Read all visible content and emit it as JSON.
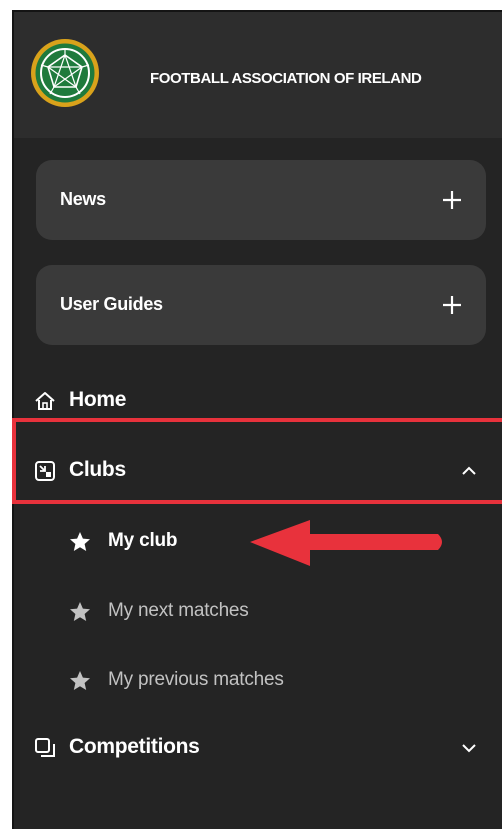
{
  "header": {
    "org_name": "FOOTBALL ASSOCIATION OF IRELAND",
    "logo_icon": "faoi-crest-icon"
  },
  "accordions": [
    {
      "label": "News",
      "toggle_icon": "plus-icon"
    },
    {
      "label": "User Guides",
      "toggle_icon": "plus-icon"
    }
  ],
  "nav": {
    "home": {
      "label": "Home",
      "icon": "home-icon"
    },
    "clubs": {
      "label": "Clubs",
      "icon": "clubs-icon",
      "state": "expanded",
      "chevron_icon": "chevron-up-icon",
      "items": [
        {
          "label": "My club",
          "icon": "star-icon",
          "active": true
        },
        {
          "label": "My next matches",
          "icon": "star-icon",
          "active": false
        },
        {
          "label": "My previous matches",
          "icon": "star-icon",
          "active": false
        }
      ]
    },
    "competitions": {
      "label": "Competitions",
      "icon": "competitions-icon",
      "state": "collapsed",
      "chevron_icon": "chevron-down-icon"
    }
  },
  "annotation": {
    "highlight_color": "#e8323c",
    "arrow_color": "#e8323c"
  },
  "colors": {
    "panel_bg": "#242424",
    "header_bg": "#2d2d2d",
    "accordion_bg": "#3a3a3a",
    "logo_green": "#1f7a3c",
    "logo_gold": "#d9a21b",
    "text_primary": "#ffffff",
    "text_muted": "#c2c2c2"
  }
}
